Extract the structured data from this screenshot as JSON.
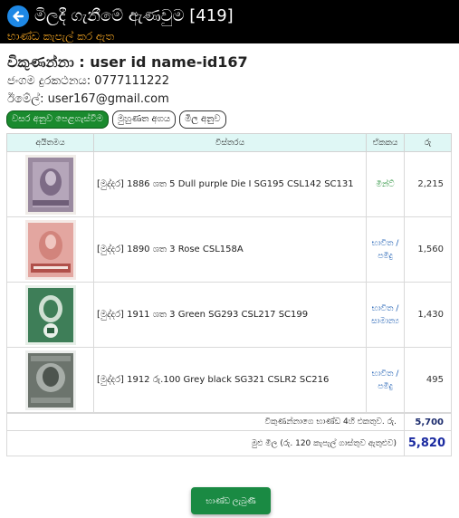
{
  "header": {
    "title": "මිලදී ගැනීමේ ඇණවුම [419]",
    "subtitle": "භාණ්ඩ කැපැල් කර ඇත"
  },
  "seller": {
    "name_line": "විකුණන්නා : user id name-id167",
    "phone_line": "ජංගම දුරකථනය: 0777111222",
    "email_line": "ඊමේල්: user167@gmail.com"
  },
  "tabs": [
    {
      "label": "වසර අනුව පෙළගැස්වීම",
      "active": true
    },
    {
      "label": "මුහුණත අගය",
      "active": false
    },
    {
      "label": "මිල අනුව",
      "active": false
    }
  ],
  "table": {
    "headers": {
      "item": "අයිතමය",
      "description": "විස්තරය",
      "unit": "ඒකකය",
      "price": "රු"
    },
    "rows": [
      {
        "image": "stamp-1886-dull-purple",
        "description": "[මුද්දර] 1886 ශත 5 Dull purple Die I SG195 CSL142 SC131",
        "unit_line1": "මින්ට්",
        "unit_line2": "",
        "unit_color": "#1a8a2e",
        "price": "2,215"
      },
      {
        "image": "stamp-1890-rose-three-cents",
        "description": "[මුද්දර] 1890 ශත 3 Rose CSL158A",
        "unit_line1": "භාවිත /",
        "unit_line2": "පමිදු",
        "unit_color": "#1e5fb3",
        "price": "1,560"
      },
      {
        "image": "stamp-1911-green-3c",
        "description": "[මුද්දර] 1911 ශත 3 Green SG293 CSL217 SC199",
        "unit_line1": "භාවිත /",
        "unit_line2": "සාමාන්‍ය",
        "unit_color": "#1e5fb3",
        "price": "1,430"
      },
      {
        "image": "stamp-1912-grey-black",
        "description": "[මුද්දර] 1912 රු.100 Grey black SG321 CSLR2 SC216",
        "unit_line1": "භාවිත /",
        "unit_line2": "පමිදු",
        "unit_color": "#1e5fb3",
        "price": "495"
      }
    ]
  },
  "totals": {
    "subtotal_label": "විකුණන්නාගෙ භාණ්ඩ 4හි එකතුව. රු.",
    "subtotal_value": "5,700",
    "grand_label": "මුළු මිල (රු. 120 කැපැල් ගාස්තුව ඇතුළුව)",
    "grand_value": "5,820"
  },
  "actions": {
    "submit_label": "භාණ්ඩ ලැබුණි"
  },
  "colors": {
    "header_bg": "#000000",
    "subtitle": "#f5a623",
    "accent_green": "#1a8a2e",
    "accent_blue": "#1e5fb3",
    "table_header_bg": "#dff7f5"
  },
  "icons": {
    "back": "back-arrow-icon"
  }
}
